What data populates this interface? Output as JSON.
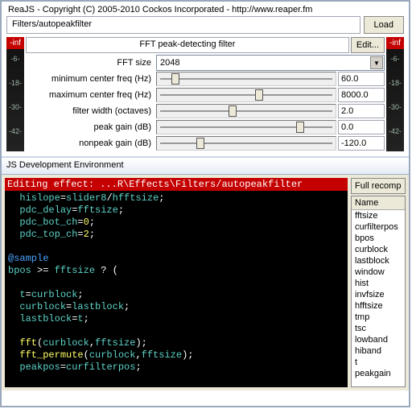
{
  "title": "ReaJS - Copyright (C) 2005-2010 Cockos Incorporated - http://www.reaper.fm",
  "path": "Filters/autopeakfilter",
  "load_label": "Load",
  "filter_title": "FFT peak-detecting filter",
  "edit_label": "Edit...",
  "meter_inf": "-inf",
  "meter_ticks": [
    "-6-",
    "-18-",
    "-30-",
    "-42-"
  ],
  "params": [
    {
      "label": "FFT size",
      "type": "dropdown",
      "value": "2048"
    },
    {
      "label": "minimum center freq (Hz)",
      "type": "slider",
      "value": "60.0",
      "pos": 8
    },
    {
      "label": "maximum center freq (Hz)",
      "type": "slider",
      "value": "8000.0",
      "pos": 55
    },
    {
      "label": "filter width (octaves)",
      "type": "slider",
      "value": "2.0",
      "pos": 40
    },
    {
      "label": "peak gain (dB)",
      "type": "slider",
      "value": "0.0",
      "pos": 78
    },
    {
      "label": "nonpeak gain (dB)",
      "type": "slider",
      "value": "-120.0",
      "pos": 22
    }
  ],
  "dev_title": "JS Development Environment",
  "editor_head": "Editing effect: ...R\\Effects\\Filters/autopeakfilter",
  "code_lines": [
    {
      "indent": 2,
      "spans": [
        {
          "t": "hislope",
          "c": "teal"
        },
        {
          "t": "=",
          "c": "w"
        },
        {
          "t": "slider8",
          "c": "teal"
        },
        {
          "t": "/",
          "c": "w"
        },
        {
          "t": "hfftsize",
          "c": "teal"
        },
        {
          "t": ";",
          "c": "w"
        }
      ]
    },
    {
      "indent": 2,
      "spans": [
        {
          "t": "pdc_delay",
          "c": "teal"
        },
        {
          "t": "=",
          "c": "w"
        },
        {
          "t": "fftsize",
          "c": "teal"
        },
        {
          "t": ";",
          "c": "w"
        }
      ]
    },
    {
      "indent": 2,
      "spans": [
        {
          "t": "pdc_bot_ch",
          "c": "teal"
        },
        {
          "t": "=",
          "c": "w"
        },
        {
          "t": "0",
          "c": "yellow"
        },
        {
          "t": ";",
          "c": "w"
        }
      ]
    },
    {
      "indent": 2,
      "spans": [
        {
          "t": "pdc_top_ch",
          "c": "teal"
        },
        {
          "t": "=",
          "c": "w"
        },
        {
          "t": "2",
          "c": "yellow"
        },
        {
          "t": ";",
          "c": "w"
        }
      ]
    },
    {
      "indent": 0,
      "spans": []
    },
    {
      "indent": 0,
      "spans": [
        {
          "t": "@sample",
          "c": "blue"
        }
      ]
    },
    {
      "indent": 0,
      "spans": [
        {
          "t": "bpos",
          "c": "teal"
        },
        {
          "t": " >= ",
          "c": "w"
        },
        {
          "t": "fftsize",
          "c": "teal"
        },
        {
          "t": " ? (",
          "c": "w"
        }
      ]
    },
    {
      "indent": 0,
      "spans": []
    },
    {
      "indent": 2,
      "spans": [
        {
          "t": "t",
          "c": "teal"
        },
        {
          "t": "=",
          "c": "w"
        },
        {
          "t": "curblock",
          "c": "teal"
        },
        {
          "t": ";",
          "c": "w"
        }
      ]
    },
    {
      "indent": 2,
      "spans": [
        {
          "t": "curblock",
          "c": "teal"
        },
        {
          "t": "=",
          "c": "w"
        },
        {
          "t": "lastblock",
          "c": "teal"
        },
        {
          "t": ";",
          "c": "w"
        }
      ]
    },
    {
      "indent": 2,
      "spans": [
        {
          "t": "lastblock",
          "c": "teal"
        },
        {
          "t": "=",
          "c": "w"
        },
        {
          "t": "t",
          "c": "teal"
        },
        {
          "t": ";",
          "c": "w"
        }
      ]
    },
    {
      "indent": 0,
      "spans": []
    },
    {
      "indent": 2,
      "spans": [
        {
          "t": "fft",
          "c": "yellow"
        },
        {
          "t": "(",
          "c": "w"
        },
        {
          "t": "curblock",
          "c": "teal"
        },
        {
          "t": ",",
          "c": "w"
        },
        {
          "t": "fftsize",
          "c": "teal"
        },
        {
          "t": ");",
          "c": "w"
        }
      ]
    },
    {
      "indent": 2,
      "spans": [
        {
          "t": "fft_permute",
          "c": "yellow"
        },
        {
          "t": "(",
          "c": "w"
        },
        {
          "t": "curblock",
          "c": "teal"
        },
        {
          "t": ",",
          "c": "w"
        },
        {
          "t": "fftsize",
          "c": "teal"
        },
        {
          "t": ");",
          "c": "w"
        }
      ]
    },
    {
      "indent": 2,
      "spans": [
        {
          "t": "peakpos",
          "c": "teal"
        },
        {
          "t": "=",
          "c": "w"
        },
        {
          "t": "curfilterpos",
          "c": "teal"
        },
        {
          "t": ";",
          "c": "w"
        }
      ]
    }
  ],
  "recompile_label": "Full recomp",
  "var_header": "Name",
  "vars": [
    "fftsize",
    "curfilterpos",
    "bpos",
    "curblock",
    "lastblock",
    "window",
    "hist",
    "invfsize",
    "hfftsize",
    "tmp",
    "tsc",
    "lowband",
    "hiband",
    "t",
    "peakgain"
  ]
}
